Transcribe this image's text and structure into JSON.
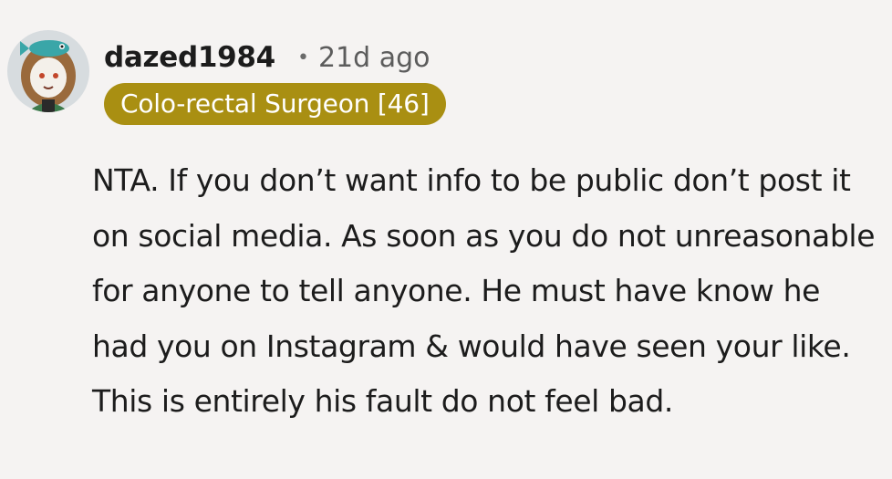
{
  "comment": {
    "avatar_icon": "user-avatar-icon",
    "username": "dazed1984",
    "separator": "•",
    "time": "21d ago",
    "flair": "Colo-rectal Surgeon [46]",
    "body": "NTA. If you don’t want info to be public don’t post it on social media. As soon as you do not unreasonable for anyone to tell anyone. He must have know he had you on Instagram & would have seen your like. This is entirely his fault do not feel bad."
  },
  "colors": {
    "background": "#f5f3f2",
    "flair_background": "#a98f12",
    "flair_text": "#ffffff",
    "text": "#1c1c1c",
    "meta_text": "#5c5c5c"
  }
}
